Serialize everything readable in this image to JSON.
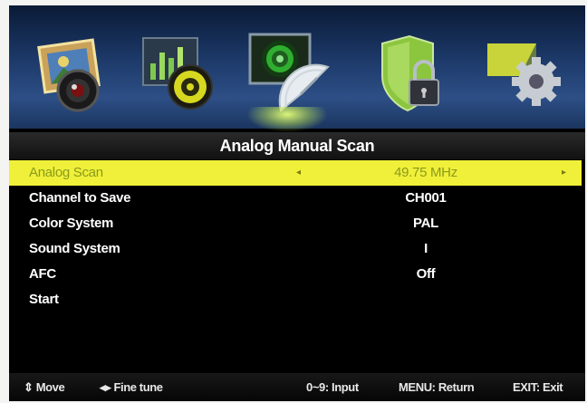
{
  "screen": {
    "title": "Analog Manual Scan"
  },
  "icons": [
    {
      "name": "picture-icon"
    },
    {
      "name": "sound-icon"
    },
    {
      "name": "channel-icon"
    },
    {
      "name": "lock-icon"
    },
    {
      "name": "setup-icon"
    }
  ],
  "selected_icon_index": 2,
  "rows": [
    {
      "label": "Analog Scan",
      "value": "49.75 MHz",
      "selected": true
    },
    {
      "label": "Channel to Save",
      "value": "CH001"
    },
    {
      "label": "Color System",
      "value": "PAL"
    },
    {
      "label": "Sound System",
      "value": "I"
    },
    {
      "label": "AFC",
      "value": "Off"
    },
    {
      "label": "Start",
      "value": ""
    }
  ],
  "arrows": {
    "left": "◂",
    "right": "▸"
  },
  "footer": {
    "move": "⇕ Move",
    "fine_tune": "◂▸ Fine tune",
    "input": "0~9: Input",
    "return": "MENU: Return",
    "exit": "EXIT: Exit"
  },
  "colors": {
    "highlight": "#f0f03a",
    "highlight_text": "#8a9a1a",
    "icon_bar": "#1d3a6a",
    "text": "#ffffff"
  }
}
